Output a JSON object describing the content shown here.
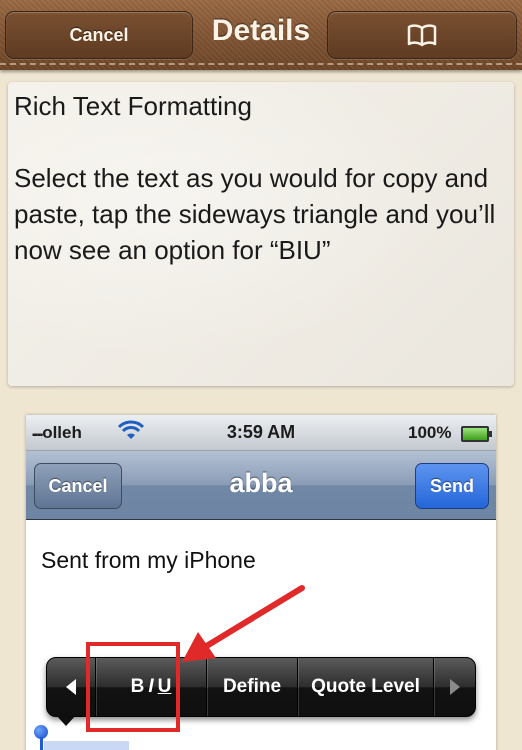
{
  "header": {
    "title": "Details",
    "cancel_label": "Cancel",
    "book_icon": "book-icon"
  },
  "note": {
    "text": "Rich Text Formatting\n\nSelect the text as you would for copy and paste, tap the sideways triangle and you’ll now see an option for “BIU”"
  },
  "screenshot": {
    "status": {
      "carrier": "olleh",
      "time": "3:59 AM",
      "battery": "100%"
    },
    "nav": {
      "title": "abba",
      "cancel_label": "Cancel",
      "send_label": "Send"
    },
    "body_text": "Sent from my iPhone",
    "edit_menu": {
      "bold": "B",
      "italic": "I",
      "underline": "U",
      "define": "Define",
      "quote_level": "Quote Level"
    }
  },
  "colors": {
    "highlight": "#e02a2a",
    "leather": "#7f5433"
  }
}
